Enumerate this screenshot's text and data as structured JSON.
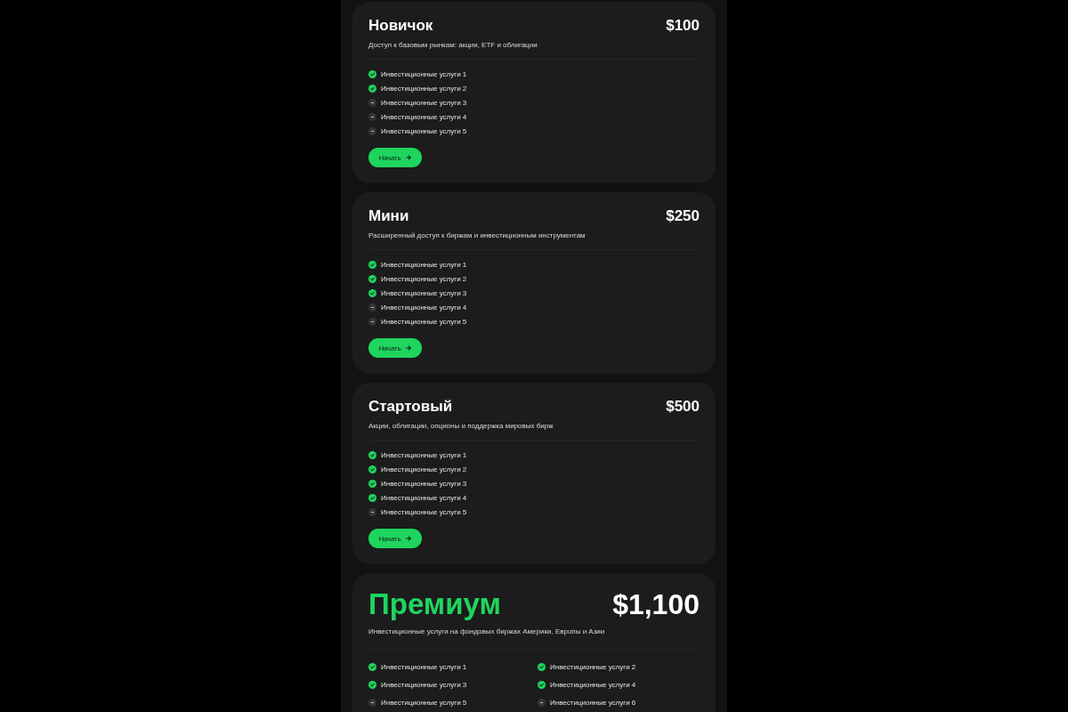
{
  "plans": [
    {
      "kind": "standard",
      "title": "Новичок",
      "price": "$100",
      "description": "Доступ к базовым рынкам: акции, ETF и облигации",
      "features": [
        {
          "label": "Инвестиционные услуги 1",
          "included": true
        },
        {
          "label": "Инвестиционные услуги 2",
          "included": true
        },
        {
          "label": "Инвестиционные услуги 3",
          "included": false
        },
        {
          "label": "Инвестиционные услуги 4",
          "included": false
        },
        {
          "label": "Инвестиционные услуги 5",
          "included": false
        }
      ],
      "button": {
        "label": "Начать"
      }
    },
    {
      "kind": "standard",
      "title": "Мини",
      "price": "$250",
      "description": "Расширенный доступ к биржам и инвестиционным инструментам",
      "features": [
        {
          "label": "Инвестиционные услуги 1",
          "included": true
        },
        {
          "label": "Инвестиционные услуги 2",
          "included": true
        },
        {
          "label": "Инвестиционные услуги 3",
          "included": true
        },
        {
          "label": "Инвестиционные услуги 4",
          "included": false
        },
        {
          "label": "Инвестиционные услуги 5",
          "included": false
        }
      ],
      "button": {
        "label": "Начать"
      }
    },
    {
      "kind": "standard",
      "title": "Стартовый",
      "price": "$500",
      "description": "Акции, облигации, опционы и поддержка мировых бирж",
      "features": [
        {
          "label": "Инвестиционные услуги 1",
          "included": true
        },
        {
          "label": "Инвестиционные услуги 2",
          "included": true
        },
        {
          "label": "Инвестиционные услуги 3",
          "included": true
        },
        {
          "label": "Инвестиционные услуги 4",
          "included": true
        },
        {
          "label": "Инвестиционные услуги 5",
          "included": false
        }
      ],
      "button": {
        "label": "Начать"
      }
    },
    {
      "kind": "featured",
      "title": "Премиум",
      "price": "$1,100",
      "description": "Инвестиционные услуги на фондовых биржах Америки, Европы и Азии",
      "features": [
        {
          "label": "Инвестиционные услуги 1",
          "included": true
        },
        {
          "label": "Инвестиционные услуги 2",
          "included": true
        },
        {
          "label": "Инвестиционные услуги 3",
          "included": true
        },
        {
          "label": "Инвестиционные услуги 4",
          "included": true
        },
        {
          "label": "Инвестиционные услуги 5",
          "included": false
        },
        {
          "label": "Инвестиционные услуги 6",
          "included": false
        }
      ]
    }
  ]
}
